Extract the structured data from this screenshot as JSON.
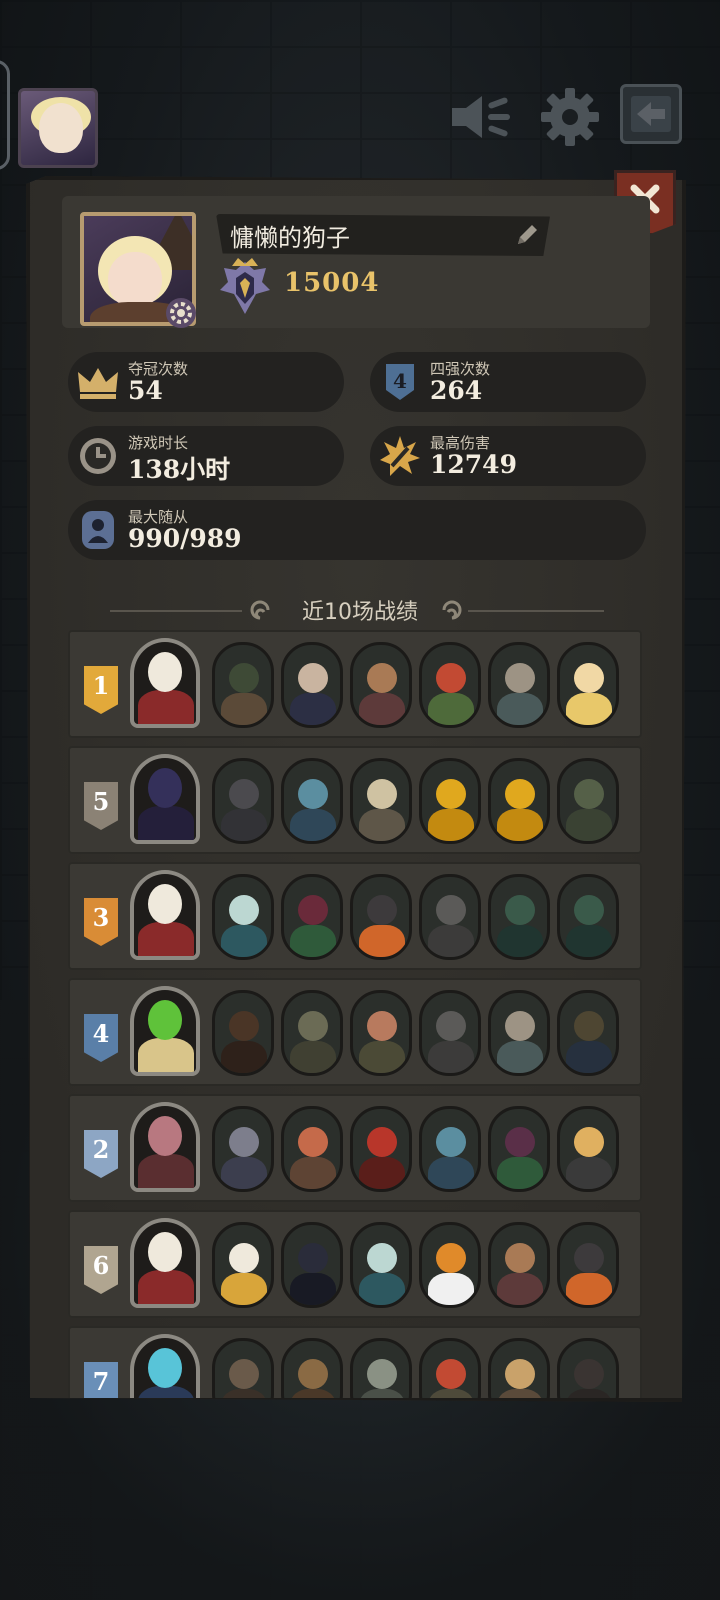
{
  "profile": {
    "player_name": "慵懒的狗子",
    "rating": "15004"
  },
  "stats": {
    "crowns": {
      "label": "夺冠次数",
      "value": "54",
      "icon": "crown-icon"
    },
    "top4": {
      "label": "四强次数",
      "value": "264",
      "icon": "top4-shield-icon"
    },
    "play_time": {
      "label": "游戏时长",
      "value": "138小时",
      "icon": "clock-icon"
    },
    "max_damage": {
      "label": "最高伤害",
      "value": "12749",
      "icon": "damage-burst-icon"
    },
    "max_units": {
      "label": "最大随从",
      "value": "990/989",
      "icon": "unit-icon"
    }
  },
  "recent_matches": {
    "title": "近10场战绩",
    "rows": [
      {
        "place": "1",
        "badge_color": "#e2a93a",
        "hero_colors": [
          "#efe9dc",
          "#8a2a2a"
        ],
        "units": [
          [
            "#3e4a36",
            "#5b4a38"
          ],
          [
            "#c9b4a0",
            "#2c2f44"
          ],
          [
            "#a97a55",
            "#5d3a3a"
          ],
          [
            "#c24a33",
            "#4e6a3a"
          ],
          [
            "#9d9384",
            "#4a5a5a"
          ],
          [
            "#f1d8a5",
            "#e8c86a"
          ]
        ]
      },
      {
        "place": "5",
        "badge_color": "#8b8275",
        "hero_colors": [
          "#34305a",
          "#241f3a"
        ],
        "units": [
          [
            "#4b4a4e",
            "#323236"
          ],
          [
            "#5b8ea0",
            "#2f4758"
          ],
          [
            "#cfc2a2",
            "#5e5648"
          ],
          [
            "#e0a81e",
            "#c38a10"
          ],
          [
            "#e0a81e",
            "#c38a10"
          ],
          [
            "#556048",
            "#3a4233"
          ]
        ]
      },
      {
        "place": "3",
        "badge_color": "#d98c36",
        "hero_colors": [
          "#efe9dc",
          "#8a2a2a"
        ],
        "units": [
          [
            "#bcd7d2",
            "#2d5860"
          ],
          [
            "#6a2a3a",
            "#2f5a3a"
          ],
          [
            "#3d3a3c",
            "#d0662a"
          ],
          [
            "#5b5a58",
            "#3c3b3a"
          ],
          [
            "#3a5a4a",
            "#203530"
          ],
          [
            "#3a5a4a",
            "#203530"
          ]
        ]
      },
      {
        "place": "4",
        "badge_color": "#5a7fa8",
        "hero_colors": [
          "#5fc23a",
          "#d9c58a"
        ],
        "units": [
          [
            "#4a3526",
            "#2e211a"
          ],
          [
            "#6b6b55",
            "#404032"
          ],
          [
            "#b87a5e",
            "#4b4a36"
          ],
          [
            "#5b5a58",
            "#3c3b3a"
          ],
          [
            "#9d9384",
            "#4a5a5a"
          ],
          [
            "#4e4632",
            "#26303e"
          ]
        ]
      },
      {
        "place": "2",
        "badge_color": "#8da6c4",
        "hero_colors": [
          "#b87880",
          "#5a2e30"
        ],
        "units": [
          [
            "#7d7e8c",
            "#3c3e4e"
          ],
          [
            "#c56a4a",
            "#5e4434"
          ],
          [
            "#b8362a",
            "#5a1e1a"
          ],
          [
            "#5b8ea0",
            "#2f4758"
          ],
          [
            "#5a2f48",
            "#2f5a3a"
          ],
          [
            "#e0b060",
            "#3a3a3a"
          ]
        ]
      },
      {
        "place": "6",
        "badge_color": "#b0a590",
        "hero_colors": [
          "#efe9dc",
          "#8a2a2a"
        ],
        "units": [
          [
            "#efe9dc",
            "#d8a53a"
          ],
          [
            "#2a2c3a",
            "#181a24"
          ],
          [
            "#bcd7d2",
            "#2d5860"
          ],
          [
            "#e08a2a",
            "#f0f0f0"
          ],
          [
            "#a97a55",
            "#5d3a3a"
          ],
          [
            "#3d3a3c",
            "#d0662a"
          ]
        ]
      },
      {
        "place": "7",
        "badge_color": "#6a8fb8",
        "hero_colors": [
          "#58c4d8",
          "#2a3a58"
        ],
        "units": [
          [
            "#6a5a4a",
            "#3a3028"
          ],
          [
            "#8a6a44",
            "#4a3828"
          ],
          [
            "#8a9184",
            "#4a5048"
          ],
          [
            "#c24a33",
            "#4e4a3a"
          ],
          [
            "#c9a26a",
            "#5a4a3a"
          ],
          [
            "#3a3432",
            "#2a2624"
          ]
        ]
      }
    ]
  },
  "colors": {
    "panel_bg": "#312f2b",
    "accent_gold": "#e9c36a",
    "close_red": "#7a2f22"
  }
}
